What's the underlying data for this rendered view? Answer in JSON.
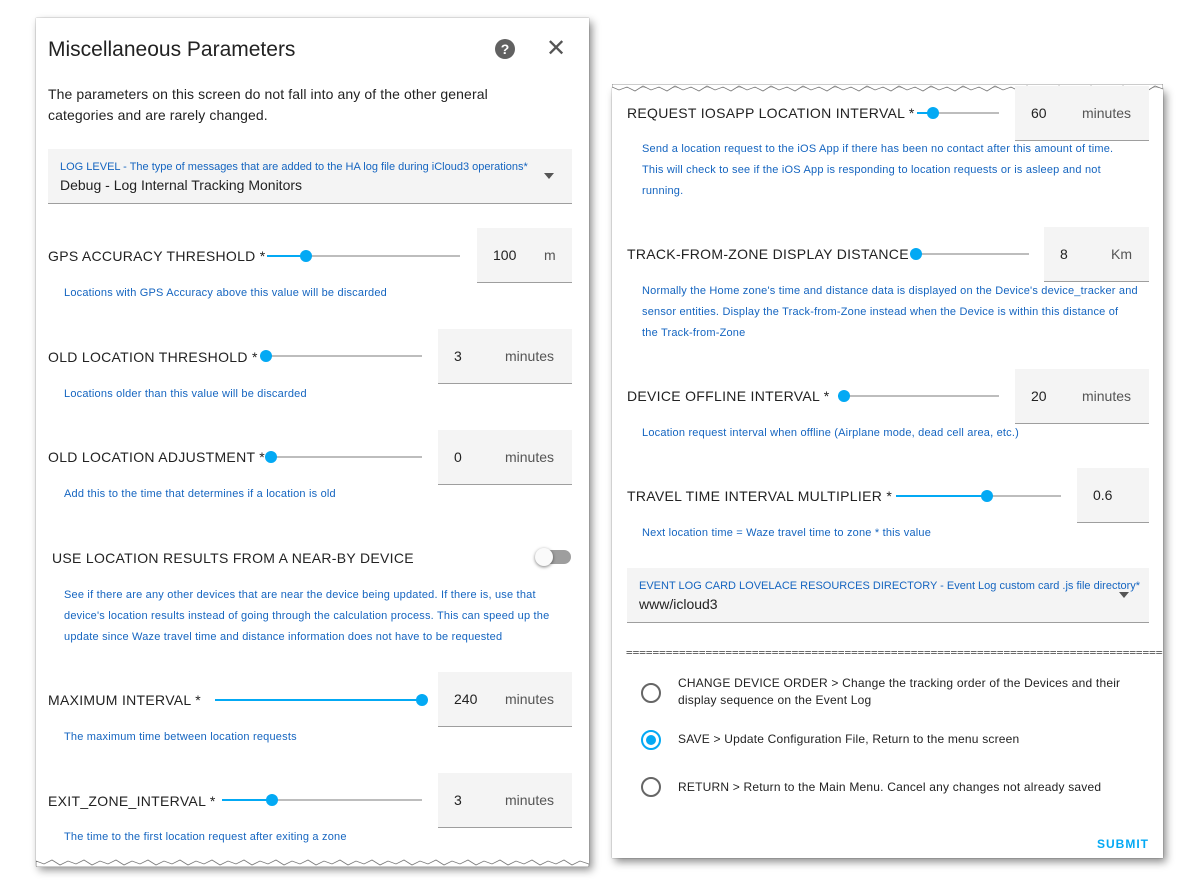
{
  "left_panel": {
    "title": "Miscellaneous Parameters",
    "intro": "The parameters on this screen do not fall into any of the other general categories and are rarely changed.",
    "log_level": {
      "label": "LOG LEVEL - The type of messages that are added to the HA log file during iCloud3 operations*",
      "value": "Debug - Log Internal Tracking Monitors"
    },
    "params": [
      {
        "label": "GPS ACCURACY THRESHOLD *",
        "value": "100",
        "unit": "m",
        "level": 0.2,
        "help": "Locations with GPS Accuracy above this value will be discarded"
      },
      {
        "label": "OLD LOCATION THRESHOLD *",
        "value": "3",
        "unit": "minutes",
        "level": 0.0,
        "help": "Locations older than this value will be discarded"
      },
      {
        "label": "OLD LOCATION ADJUSTMENT *",
        "value": "0",
        "unit": "minutes",
        "level": 0.0,
        "help": "Add this to the time that determines if a location is old"
      }
    ],
    "nearby": {
      "label": "USE LOCATION RESULTS FROM A NEAR-BY DEVICE",
      "help_1": "See if there are any other devices that are near the device being updated. If there is, use that",
      "help_2": "device's location results instead of going through the calculation process. This can speed up the",
      "help_3": "update since Waze travel time and distance information does not have to be requested",
      "enabled": false
    },
    "params2": [
      {
        "label": "MAXIMUM INTERVAL *",
        "value": "240",
        "unit": "minutes",
        "level": 1.0,
        "help": "The maximum time between location requests"
      },
      {
        "label": "EXIT_ZONE_INTERVAL *",
        "value": "3",
        "unit": "minutes",
        "level": 0.25,
        "help": "The time to the first location request after exiting a zone"
      }
    ]
  },
  "right_panel": {
    "params": [
      {
        "label": "REQUEST IOSAPP LOCATION INTERVAL *",
        "value": "60",
        "unit": "minutes",
        "level": 0.2,
        "help_1": "Send a location request to the iOS App if there has been no contact after this amount of time.",
        "help_2": "This will check to see if the iOS App is responding to location requests or is asleep and not",
        "help_3": "running."
      },
      {
        "label": "TRACK-FROM-ZONE DISPLAY DISTANCE *",
        "value": "8",
        "unit": "Km",
        "level": 0.0,
        "help_1": "Normally the Home zone's time and distance data is displayed on the Device's device_tracker and",
        "help_2": "sensor entities. Display the Track-from-Zone instead when the Device is within this distance of",
        "help_3": "the Track-from-Zone"
      },
      {
        "label": "DEVICE OFFLINE INTERVAL *",
        "value": "20",
        "unit": "minutes",
        "level": 0.04,
        "help_1": "Location request interval when offline (Airplane mode, dead cell area, etc.)"
      },
      {
        "label": "TRAVEL TIME INTERVAL MULTIPLIER *",
        "value": "0.6",
        "unit": "",
        "level": 0.55,
        "help_1": "Next location time = Waze travel time to zone * this value"
      }
    ],
    "event_log": {
      "label": "EVENT LOG CARD LOVELACE RESOURCES DIRECTORY - Event Log custom card .js file directory*",
      "value": "www/icloud3"
    },
    "divider": "==========================================================================================",
    "actions": [
      {
        "label_1": "CHANGE DEVICE ORDER > Change the tracking order of the Devices and their",
        "label_2": "display sequence on the Event Log",
        "checked": false
      },
      {
        "label_1": "SAVE > Update Configuration File, Return to the menu screen",
        "label_2": "",
        "checked": true
      },
      {
        "label_1": "RETURN > Return to the Main Menu. Cancel any changes not already saved",
        "label_2": "",
        "checked": false
      }
    ],
    "submit": "SUBMIT"
  },
  "colors": {
    "accent": "#03a9f4",
    "help_text": "#1565c0",
    "field_bg": "#f4f4f4"
  },
  "icons": {
    "help": "help-icon",
    "close": "close-icon",
    "dropdown": "chevron-down-icon"
  }
}
